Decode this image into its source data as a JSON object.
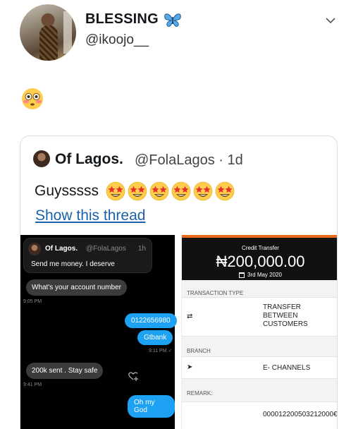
{
  "tweet": {
    "display_name": "BLESSING",
    "handle": "@ikoojo__",
    "name_emoji": "butterfly-icon",
    "body_emoji": "flushed-face-icon"
  },
  "quoted": {
    "display_name": "Of Lagos.",
    "handle": "@FolaLagos",
    "separator": "·",
    "age": "1d",
    "text": "Guysssss",
    "emoji": "star-struck-icon",
    "emoji_count": 6,
    "show_thread": "Show this thread"
  },
  "chat": {
    "preview_name": "Of Lagos.",
    "preview_handle": "@FolaLagos",
    "preview_time": "1h",
    "preview_text": "Send me money. I deserve",
    "msg1": "What's your account number",
    "ts1": "9:05 PM",
    "msg2": "0122656980",
    "msg3": "Gtbank",
    "ts2": "9:11 PM ✓",
    "msg4": "200k sent . Stay safe",
    "ts3": "9:41 PM",
    "msg5": "Oh my God"
  },
  "receipt": {
    "title": "Credit Transfer",
    "amount": "₦200,000.00",
    "date": "3rd May 2020",
    "type_label": "TRANSACTION TYPE",
    "type_value": "TRANSFER\nBETWEEN\nCUSTOMERS",
    "branch_label": "BRANCH",
    "branch_value": "E- CHANNELS",
    "remark_label": "REMARK:",
    "remark_value": "000012200503212000€",
    "accent_color": "#e86a1c"
  }
}
